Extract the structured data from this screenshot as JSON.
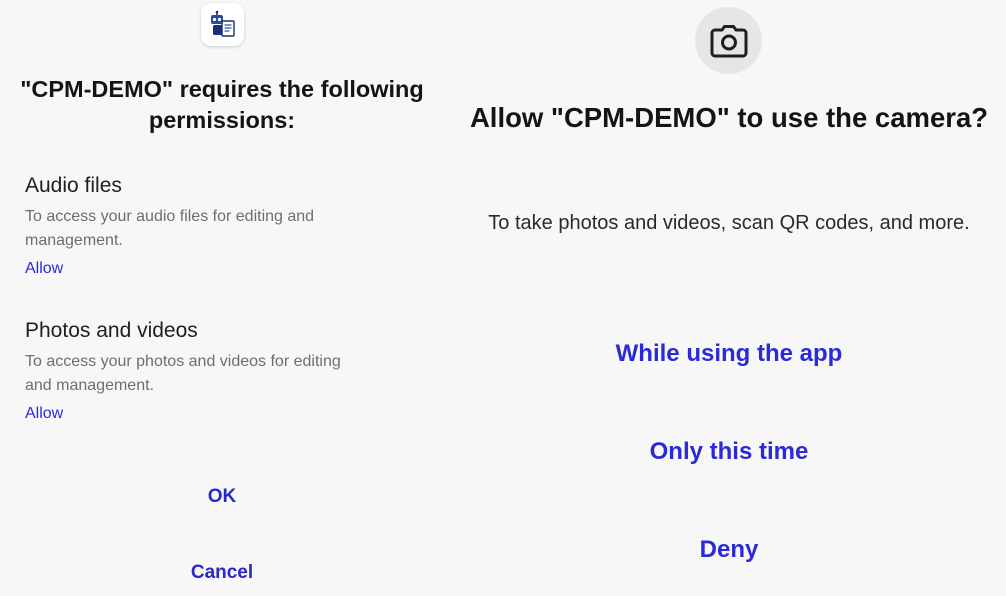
{
  "left": {
    "app_icon": "robot-app-icon",
    "title": "\"CPM-DEMO\" requires the following permissions:",
    "permissions": [
      {
        "name": "Audio files",
        "description": "To access your audio files for editing and management.",
        "action": "Allow"
      },
      {
        "name": "Photos and videos",
        "description": "To access your photos and videos for editing and management.",
        "action": "Allow"
      }
    ],
    "ok_label": "OK",
    "cancel_label": "Cancel"
  },
  "right": {
    "icon": "camera-icon",
    "title": "Allow \"CPM-DEMO\" to use the camera?",
    "description": "To take photos and videos, scan QR codes, and more.",
    "buttons": {
      "while_using": "While using the app",
      "only_this_time": "Only this time",
      "deny": "Deny"
    }
  },
  "colors": {
    "background": "#f7f7f7",
    "accent": "#2a2ad6",
    "icon_circle": "#e6e6e6",
    "secondary_text": "#6e6e6e"
  }
}
